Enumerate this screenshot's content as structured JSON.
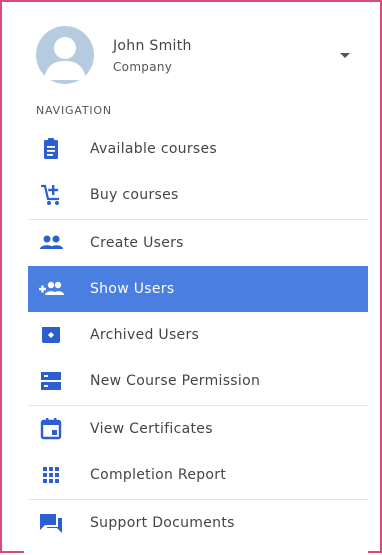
{
  "user": {
    "name": "John Smith",
    "company": "Company"
  },
  "navigation": {
    "heading": "NAVIGATION",
    "items": [
      {
        "label": "Available courses",
        "icon": "clipboard-icon"
      },
      {
        "label": "Buy courses",
        "icon": "cart-plus-icon"
      },
      {
        "label": "Create Users",
        "icon": "users-icon"
      },
      {
        "label": "Show Users",
        "icon": "add-users-icon",
        "active": true
      },
      {
        "label": "Archived Users",
        "icon": "archive-icon"
      },
      {
        "label": "New Course Permission",
        "icon": "list-icon"
      },
      {
        "label": "View Certificates",
        "icon": "calendar-icon"
      },
      {
        "label": "Completion Report",
        "icon": "grid-icon"
      },
      {
        "label": "Support Documents",
        "icon": "chat-icon"
      }
    ]
  },
  "colors": {
    "accent": "#4a7ee0",
    "icon": "#2b5fd0",
    "frame_border": "#d94b7a"
  }
}
